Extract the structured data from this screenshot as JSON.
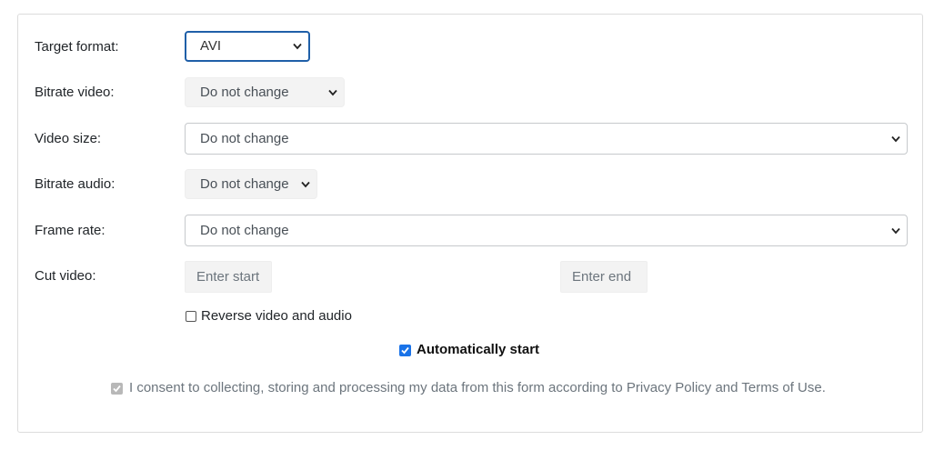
{
  "form": {
    "target_format": {
      "label": "Target format:",
      "value": "AVI"
    },
    "bitrate_video": {
      "label": "Bitrate video:",
      "value": "Do not change"
    },
    "video_size": {
      "label": "Video size:",
      "value": "Do not change"
    },
    "bitrate_audio": {
      "label": "Bitrate audio:",
      "value": "Do not change"
    },
    "frame_rate": {
      "label": "Frame rate:",
      "value": "Do not change"
    },
    "cut_video": {
      "label": "Cut video:",
      "start_placeholder": "Enter start",
      "end_placeholder": "Enter end"
    },
    "reverse": {
      "label": "Reverse video and audio",
      "checked": false
    },
    "auto_start": {
      "label": "Automatically start",
      "checked": true
    },
    "consent": {
      "label": "I consent to collecting, storing and processing my data from this form according to Privacy Policy and Terms of Use.",
      "checked": true,
      "disabled": true
    }
  },
  "colors": {
    "focus_border": "#1f5fa8",
    "checkbox_accent": "#1a73e8",
    "panel_border": "#dcdcdc"
  }
}
